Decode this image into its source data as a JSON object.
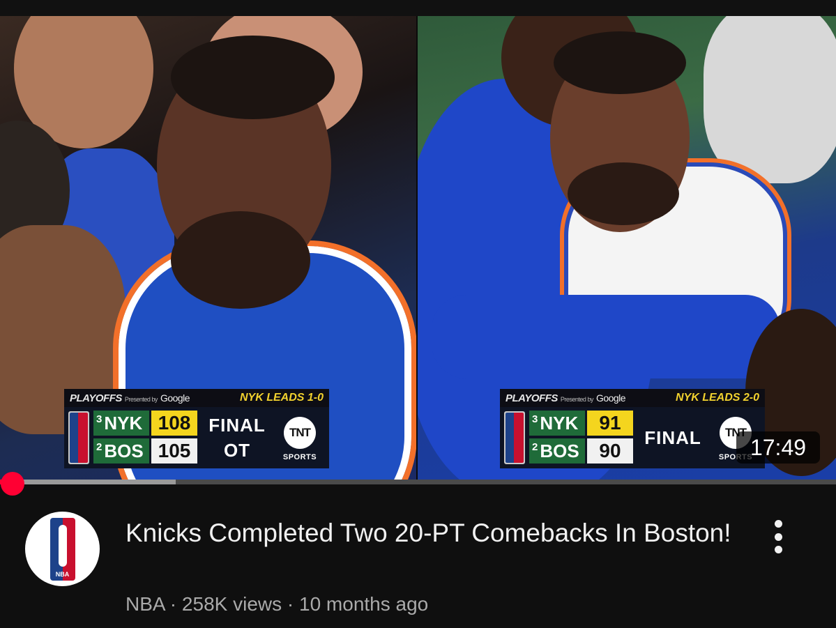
{
  "video": {
    "duration": "17:49",
    "progress_fraction": 0.015,
    "buffer_fraction": 0.21,
    "frames": [
      {
        "scorebug": {
          "brand": "PLAYOFFS",
          "presented_by": "Presented by",
          "sponsor": "Google",
          "series": "NYK LEADS 1-0",
          "teams": [
            {
              "seed": "3",
              "abbr": "NYK",
              "score": "108"
            },
            {
              "seed": "2",
              "abbr": "BOS",
              "score": "105"
            }
          ],
          "status_line1": "FINAL",
          "status_line2": "OT",
          "network": "TNT",
          "network_sub": "SPORTS"
        }
      },
      {
        "scorebug": {
          "brand": "PLAYOFFS",
          "presented_by": "Presented by",
          "sponsor": "Google",
          "series": "NYK LEADS 2-0",
          "teams": [
            {
              "seed": "3",
              "abbr": "NYK",
              "score": "91"
            },
            {
              "seed": "2",
              "abbr": "BOS",
              "score": "90"
            }
          ],
          "status_line1": "FINAL",
          "network": "TNT",
          "network_sub": "SPORTS"
        }
      }
    ]
  },
  "channel": {
    "name": "NBA",
    "avatar_icon": "nba-logo-icon"
  },
  "title": "Knicks Completed Two 20-PT Comebacks In Boston!",
  "meta": {
    "channel": "NBA",
    "views": "258K views",
    "age": "10 months ago",
    "separator": " · "
  },
  "colors": {
    "progress": "#ff0033",
    "lead_score": "#f4d51e",
    "team_box": "#1f6b39",
    "background": "#0f0f0f"
  }
}
